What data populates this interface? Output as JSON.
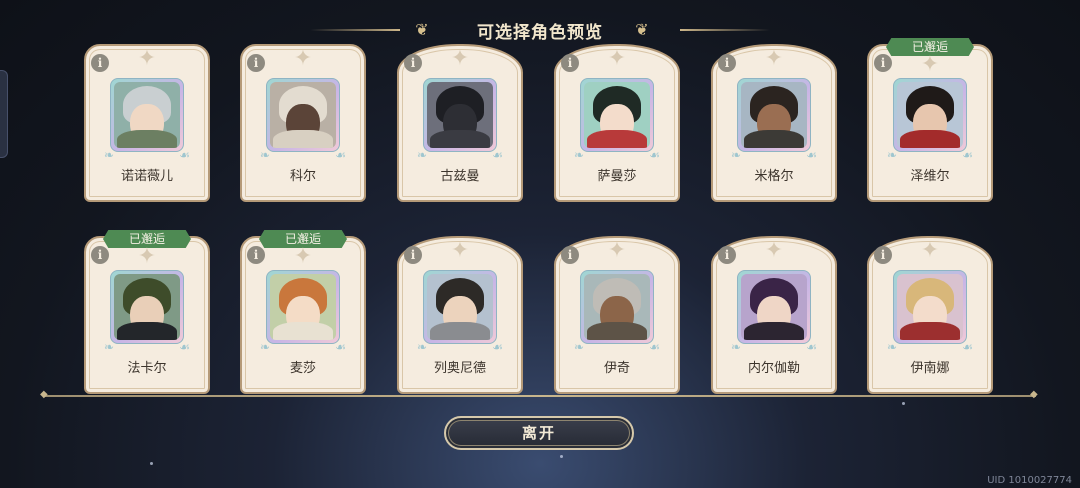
{
  "header": {
    "title": "可选择角色预览"
  },
  "met_label": "已邂逅",
  "info_glyph": "i",
  "characters": [
    {
      "name": "诺诺薇儿",
      "met": false
    },
    {
      "name": "科尔",
      "met": false
    },
    {
      "name": "古兹曼",
      "met": false
    },
    {
      "name": "萨曼莎",
      "met": false
    },
    {
      "name": "米格尔",
      "met": false
    },
    {
      "name": "泽维尔",
      "met": true
    },
    {
      "name": "法卡尔",
      "met": true
    },
    {
      "name": "麦莎",
      "met": true
    },
    {
      "name": "列奥尼德",
      "met": false
    },
    {
      "name": "伊奇",
      "met": false
    },
    {
      "name": "内尔伽勒",
      "met": false
    },
    {
      "name": "伊南娜",
      "met": false
    }
  ],
  "actions": {
    "leave_label": "离开"
  },
  "footer": {
    "uid": "UID 1010027774"
  }
}
